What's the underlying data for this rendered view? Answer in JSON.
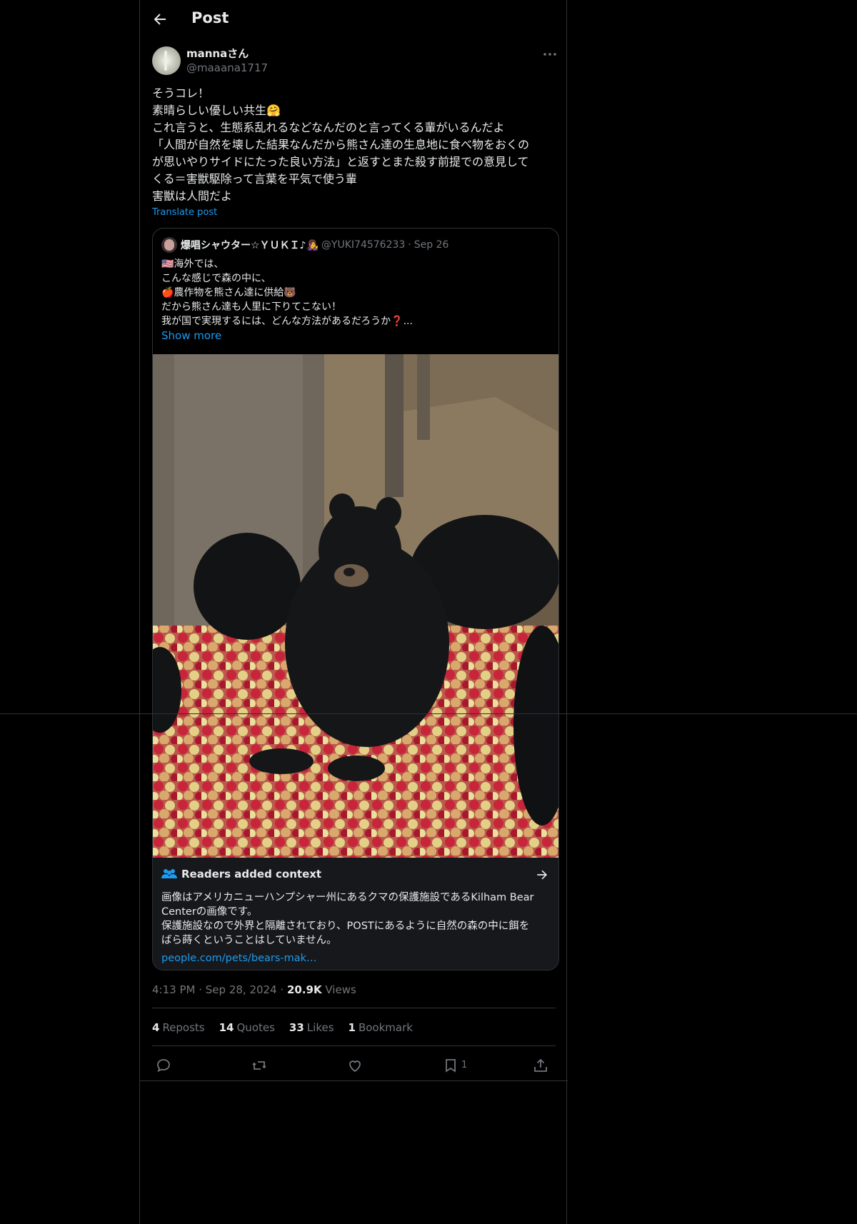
{
  "header": {
    "title": "Post"
  },
  "post": {
    "author_name": "mannaさん",
    "author_handle": "@maaana1717",
    "lines": [
      "そうコレ！",
      "素晴らしい優しい共生🤗",
      "これ言うと、生態系乱れるなどなんだのと言ってくる輩がいるんだよ",
      "「人間が自然を壊した結果なんだから熊さん達の生息地に食べ物をおくの",
      "が思いやりサイドにたった良い方法」と返すとまた殺す前提での意見して",
      "くる＝害獣駆除って言葉を平気で使う輩",
      "害獣は人間だよ"
    ],
    "translate_label": "Translate post",
    "time": "4:13 PM",
    "date": "Sep 28, 2024",
    "views_count": "20.9K",
    "views_label": "Views"
  },
  "quote": {
    "author_name": "爆唱シャウター☆ＹＵＫＩ♪👩‍🎤",
    "author_handle": "@YUKI74576233",
    "date": "Sep 26",
    "lines": [
      "🇺🇸海外では、",
      "こんな感じで森の中に、",
      "🍎農作物を熊さん達に供給🐻",
      "だから熊さん達も人里に下りてこない！",
      "我が国で実現するには、どんな方法があるだろうか❓..."
    ],
    "show_more": "Show more"
  },
  "community_note": {
    "title": "Readers added context",
    "lines": [
      "画像はアメリカニューハンプシャー州にあるクマの保護施設であるKilham Bear",
      "Centerの画像です。",
      "保護施設なので外界と隔離されており、POSTにあるように自然の森の中に餌を",
      "ばら蒔くということはしていません。"
    ],
    "link": "people.com/pets/bears-mak…"
  },
  "stats": {
    "reposts_count": "4",
    "reposts_label": "Reposts",
    "quotes_count": "14",
    "quotes_label": "Quotes",
    "likes_count": "33",
    "likes_label": "Likes",
    "bookmarks_count": "1",
    "bookmarks_label": "Bookmark"
  },
  "actions": {
    "bookmark_count": "1"
  },
  "colors": {
    "accent": "#1d9bf0",
    "background": "#000000",
    "muted": "#71767b",
    "border": "#2f3336"
  },
  "icons": [
    "arrow-left-icon",
    "more-icon",
    "people-icon",
    "arrow-right-icon",
    "reply-icon",
    "repost-icon",
    "like-icon",
    "bookmark-icon",
    "share-icon"
  ]
}
